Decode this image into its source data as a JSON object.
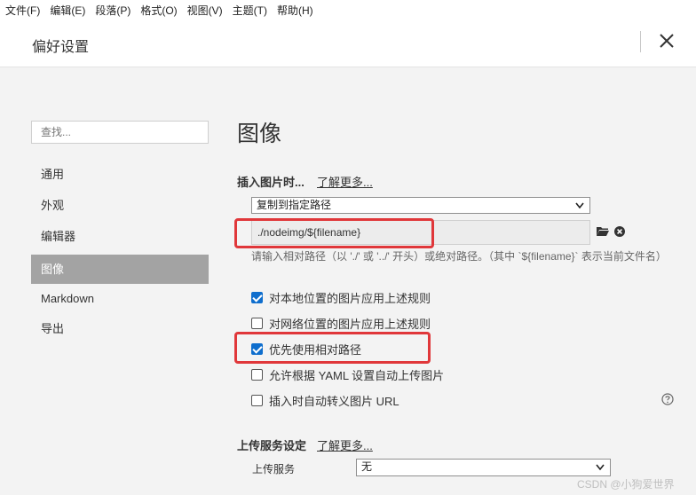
{
  "menubar": {
    "items": [
      "文件(F)",
      "编辑(E)",
      "段落(P)",
      "格式(O)",
      "视图(V)",
      "主题(T)",
      "帮助(H)"
    ]
  },
  "header": {
    "title": "偏好设置",
    "close_icon": "close-icon"
  },
  "sidebar": {
    "search_placeholder": "查找...",
    "items": [
      {
        "label": "通用",
        "active": false
      },
      {
        "label": "外观",
        "active": false
      },
      {
        "label": "编辑器",
        "active": false
      },
      {
        "label": "图像",
        "active": true
      },
      {
        "label": "Markdown",
        "active": false
      },
      {
        "label": "导出",
        "active": false
      }
    ]
  },
  "main": {
    "title": "图像",
    "insert_section": {
      "title": "插入图片时...",
      "learn_more": "了解更多...",
      "action_select": "复制到指定路径",
      "path_value": "./nodeimg/${filename}",
      "hint": "请输入相对路径（以 './' 或 '../' 开头）或绝对路径。（其中 `${filename}` 表示当前文件名）",
      "checkboxes": [
        {
          "label": "对本地位置的图片应用上述规则",
          "checked": true
        },
        {
          "label": "对网络位置的图片应用上述规则",
          "checked": false
        },
        {
          "label": "优先使用相对路径",
          "checked": true
        },
        {
          "label": "允许根据 YAML 设置自动上传图片",
          "checked": false
        },
        {
          "label": "插入时自动转义图片 URL",
          "checked": false
        }
      ]
    },
    "upload_section": {
      "title": "上传服务设定",
      "learn_more": "了解更多...",
      "service_label": "上传服务",
      "service_value": "无"
    }
  },
  "watermark": "CSDN @小狗爱世界",
  "colors": {
    "accent": "#0f6ecd",
    "highlight": "#e0373a",
    "active_nav": "#a3a3a3"
  }
}
